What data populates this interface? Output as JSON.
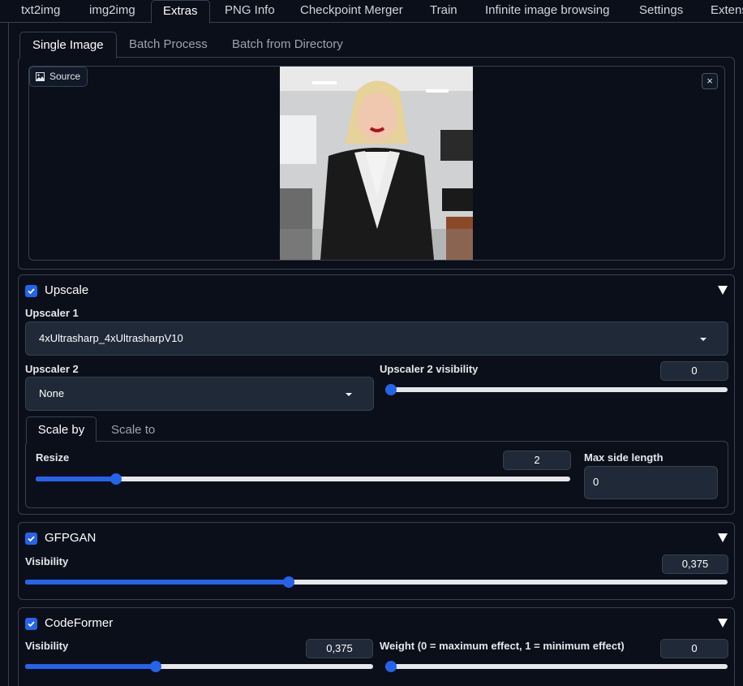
{
  "top_tabs": [
    "txt2img",
    "img2img",
    "Extras",
    "PNG Info",
    "Checkpoint Merger",
    "Train",
    "Infinite image browsing",
    "Settings",
    "Extens"
  ],
  "active_top_tab": "Extras",
  "sub_tabs": [
    "Single Image",
    "Batch Process",
    "Batch from Directory"
  ],
  "source": {
    "label": "Source",
    "close": "×"
  },
  "upscale": {
    "title": "Upscale",
    "checked": true,
    "upscaler1_label": "Upscaler 1",
    "upscaler1_value": "4xUltrasharp_4xUltrasharpV10",
    "upscaler2_label": "Upscaler 2",
    "upscaler2_value": "None",
    "upscaler2_visibility_label": "Upscaler 2 visibility",
    "upscaler2_visibility_value": "0",
    "upscaler2_visibility_fraction": 0,
    "scale_tabs": [
      "Scale by",
      "Scale to"
    ],
    "resize_label": "Resize",
    "resize_value": "2",
    "resize_fraction": 0.15,
    "max_side_label": "Max side length",
    "max_side_value": "0"
  },
  "gfpgan": {
    "title": "GFPGAN",
    "checked": true,
    "visibility_label": "Visibility",
    "visibility_value": "0,375",
    "visibility_fraction": 0.375
  },
  "codeformer": {
    "title": "CodeFormer",
    "checked": true,
    "visibility_label": "Visibility",
    "visibility_value": "0,375",
    "visibility_fraction": 0.375,
    "weight_label": "Weight (0 = maximum effect, 1 = minimum effect)",
    "weight_value": "0",
    "weight_fraction": 0
  },
  "colors": {
    "accent": "#2563eb",
    "background": "#0b0f19",
    "panel_border": "#374151",
    "input_bg": "#1f2937"
  }
}
